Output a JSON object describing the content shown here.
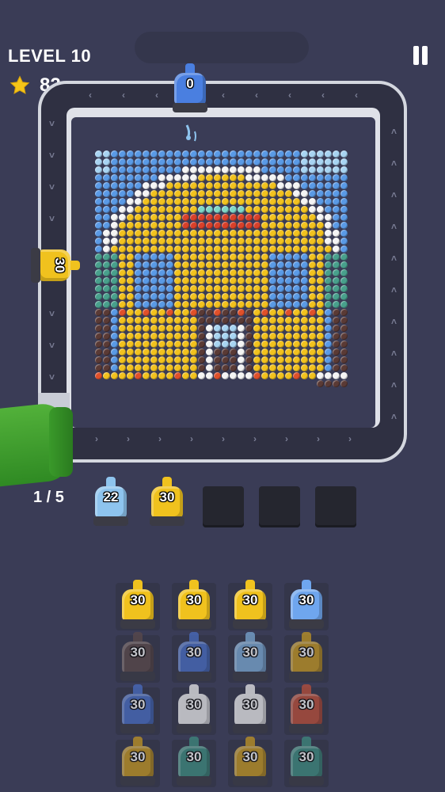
{
  "hud": {
    "level_label": "LEVEL 10",
    "stars": "82",
    "star_icon": "star-icon",
    "pause_icon": "pause-icon"
  },
  "track": {
    "cart_top": {
      "count": "0",
      "color": "#4a7fe0"
    },
    "cart_left": {
      "count": "30",
      "color": "#f0c21e"
    }
  },
  "queue": {
    "progress": "1 / 5",
    "slots": [
      {
        "count": "22",
        "color": "#8ec4ee"
      },
      {
        "count": "30",
        "color": "#f0c21e"
      },
      {
        "empty": true
      },
      {
        "empty": true
      },
      {
        "empty": true
      }
    ]
  },
  "reserve": {
    "rows": [
      [
        {
          "count": "30",
          "color": "#f0c21e"
        },
        {
          "count": "30",
          "color": "#f0c21e"
        },
        {
          "count": "30",
          "color": "#f0c21e"
        },
        {
          "count": "30",
          "color": "#6fa6ee"
        }
      ],
      [
        {
          "count": "30",
          "color": "#5c4a4a"
        },
        {
          "count": "30",
          "color": "#4a70c8"
        },
        {
          "count": "30",
          "color": "#7eaedb"
        },
        {
          "count": "30",
          "color": "#c99a22"
        }
      ],
      [
        {
          "count": "30",
          "color": "#4a70c8"
        },
        {
          "count": "30",
          "color": "#f2f2f2"
        },
        {
          "count": "30",
          "color": "#f2f2f2"
        },
        {
          "count": "30",
          "color": "#c0503a"
        }
      ],
      [
        {
          "count": "30",
          "color": "#c99a22"
        },
        {
          "count": "30",
          "color": "#3f8f82"
        },
        {
          "count": "30",
          "color": "#c99a22"
        },
        {
          "count": "30",
          "color": "#3f8f82"
        }
      ]
    ]
  },
  "palette": {
    "blue": "#5a9ae6",
    "light_blue": "#a8d4f2",
    "yellow": "#f2c21e",
    "white": "#f4f4f4",
    "teal": "#48a08c",
    "orange_red": "#e0502a",
    "brown": "#5a3a35",
    "red": "#d8402a",
    "mint": "#7ed7c8"
  }
}
